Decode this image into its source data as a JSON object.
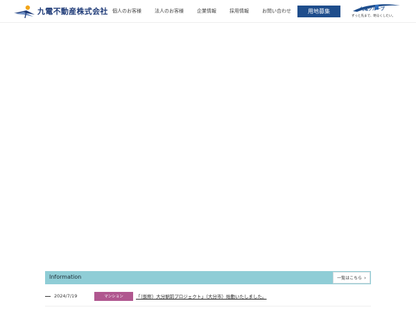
{
  "header": {
    "company_name": "九電不動産株式会社",
    "nav": [
      "個人のお客様",
      "法人のお客様",
      "企業情報",
      "採用情報",
      "お問い合わせ"
    ],
    "recruit_button": "用地募集",
    "group_name": "九電グループ",
    "group_tagline": "ずっと先まで、明るくしたい。"
  },
  "information": {
    "title": "Information",
    "more_label": "一覧はこちら",
    "items": [
      {
        "date": "2024/7/19",
        "category": "マンション",
        "text": "「（仮称）大分駅前プロジェクト」（大分市）始動いたしました。"
      }
    ]
  },
  "colors": {
    "brand_navy": "#1e4d8c",
    "info_bar": "#8fcdd6",
    "category_magenta": "#b0578f"
  }
}
